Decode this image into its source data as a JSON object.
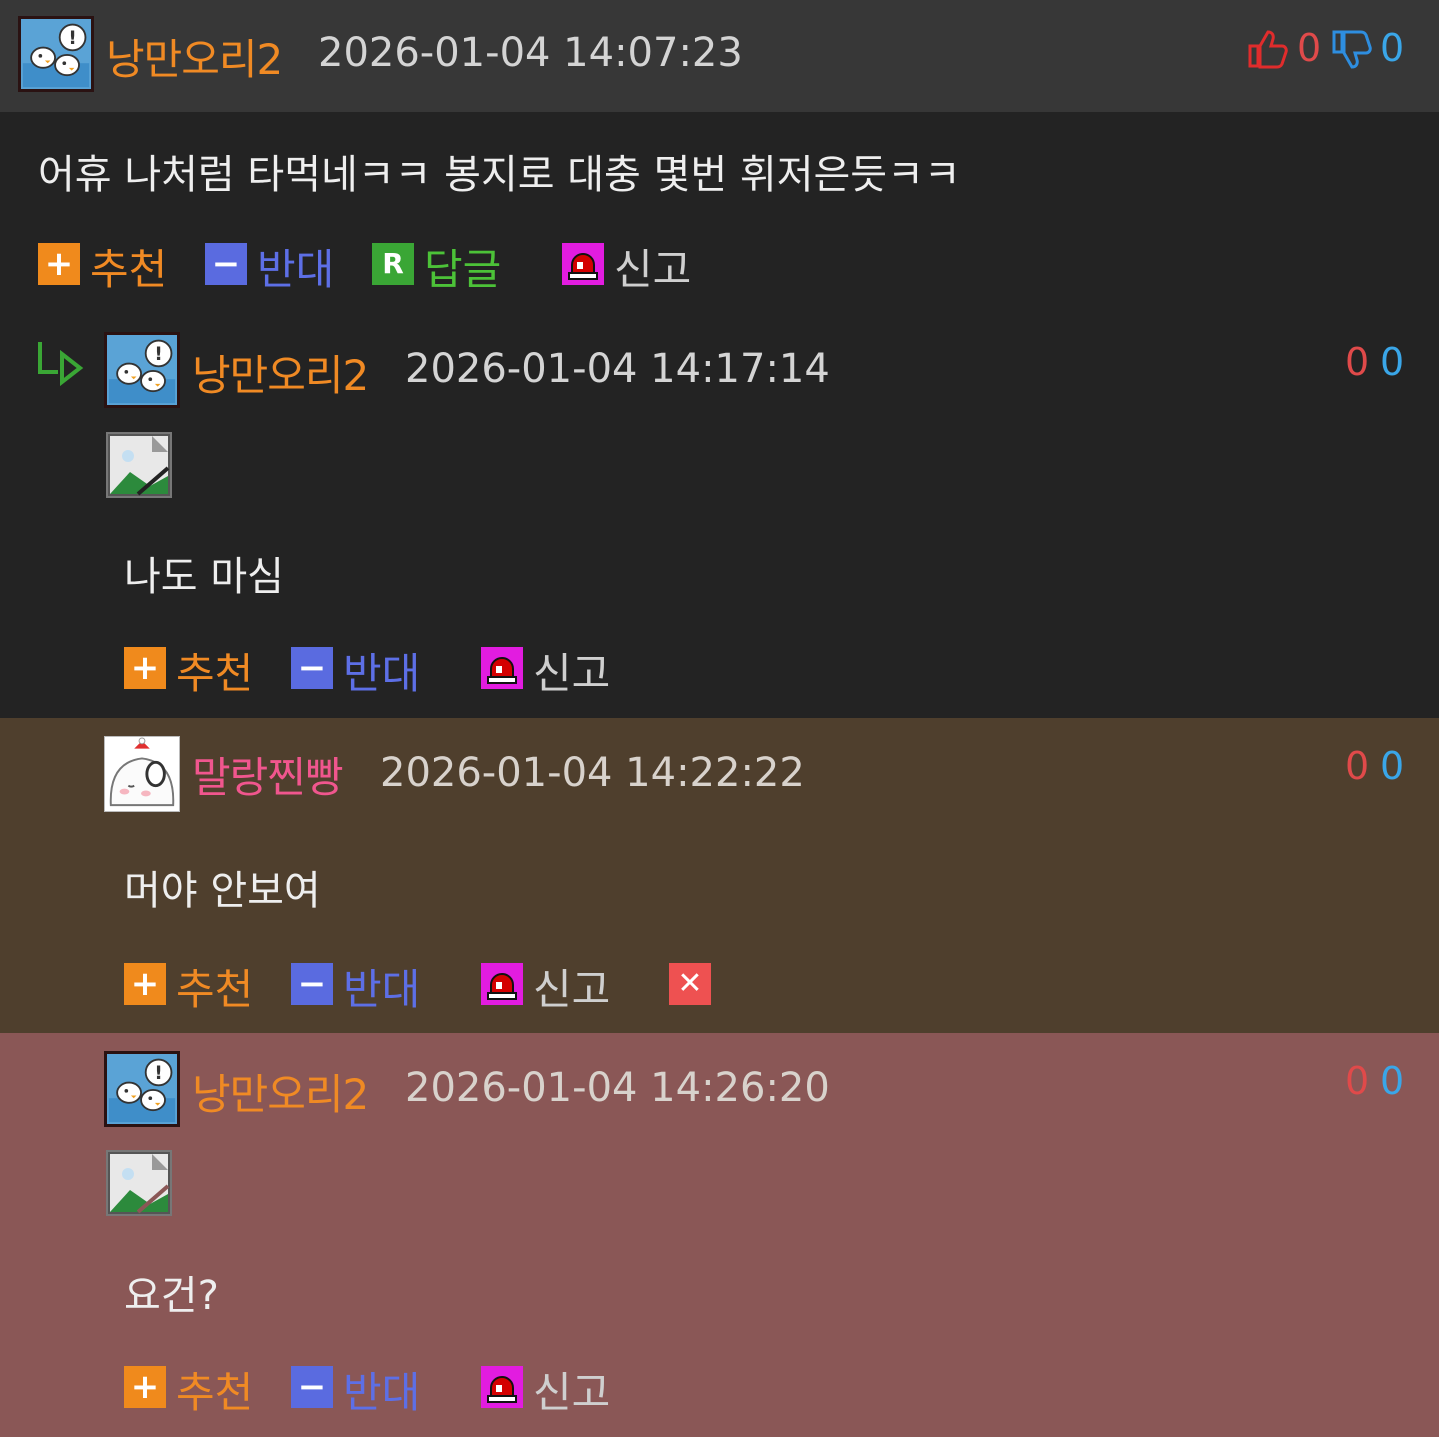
{
  "colors": {
    "top_bar": "#373737",
    "main_bg": "#232323",
    "highlight_brown": "#4f3f2d",
    "highlight_red": "#8a5756",
    "nick_orange": "#f08a24",
    "nick_pink": "#f0568e",
    "up_red": "#e04a4a",
    "down_blue": "#3aa6e8"
  },
  "top_comment": {
    "nick": "낭만오리2",
    "date": "2026-01-04 14:07:23",
    "up_count": "0",
    "down_count": "0",
    "up_icon": "thumbs-up-icon",
    "down_icon": "thumbs-down-icon",
    "text": "어휴 나처럼 타먹네ㅋㅋ 봉지로 대충 몇번 휘저은듯ㅋㅋ",
    "actions": {
      "recommend": "추천",
      "oppose": "반대",
      "reply": "답글",
      "report": "신고"
    }
  },
  "replies": [
    {
      "nick": "낭만오리2",
      "date": "2026-01-04 14:17:14",
      "up_count": "0",
      "down_count": "0",
      "text": "나도 마심",
      "actions": {
        "recommend": "추천",
        "oppose": "반대",
        "report": "신고"
      }
    },
    {
      "nick": "말랑찐빵",
      "date": "2026-01-04 14:22:22",
      "up_count": "0",
      "down_count": "0",
      "text": "머야 안보여",
      "actions": {
        "recommend": "추천",
        "oppose": "반대",
        "report": "신고"
      }
    },
    {
      "nick": "낭만오리2",
      "date": "2026-01-04 14:26:20",
      "up_count": "0",
      "down_count": "0",
      "text": "요건?",
      "actions": {
        "recommend": "추천",
        "oppose": "반대",
        "report": "신고"
      }
    }
  ]
}
